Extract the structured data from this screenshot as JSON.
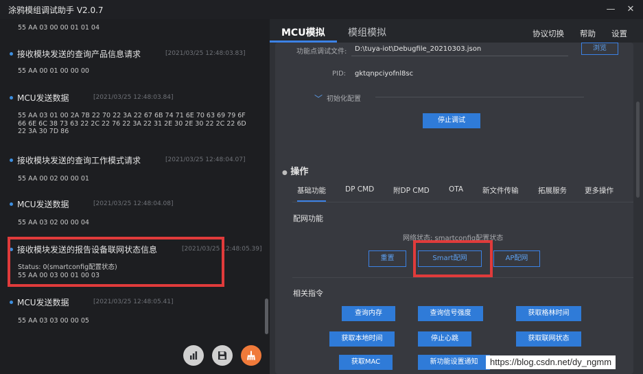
{
  "window": {
    "title": "涂鸦模组调试助手 V2.0.7",
    "minimize_glyph": "—",
    "close_glyph": "✕"
  },
  "log": {
    "entries": [
      {
        "title": "",
        "time": "",
        "body": "55 AA 03 00 00 01 01 04"
      },
      {
        "title": "接收模块发送的查询产品信息请求",
        "time": "[2021/03/25 12:48:03.83]",
        "body": "55 AA 00 01 00 00 00"
      },
      {
        "title": "MCU发送数据",
        "time": "[2021/03/25 12:48:03.84]",
        "body": "55 AA 03 01 00 2A 7B 22 70 22 3A 22 67 6B 74 71 6E 70 63 69 79 6F\n66 6E 6C 38 73 63 22 2C 22 76 22 3A 22 31 2E 30 2E 30 22 2C 22 6D\n22 3A 30 7D 86"
      },
      {
        "title": "接收模块发送的查询工作模式请求",
        "time": "[2021/03/25 12:48:04.07]",
        "body": "55 AA 00 02 00 00 01"
      },
      {
        "title": "MCU发送数据",
        "time": "[2021/03/25 12:48:04.08]",
        "body": "55 AA 03 02 00 00 04"
      },
      {
        "title": "接收模块发送的报告设备联网状态信息",
        "time": "[2021/03/25 12:48:05.39]",
        "body": "Status: 0(smartconfig配置状态)\n55 AA 00 03 00 01 00 03"
      },
      {
        "title": "MCU发送数据",
        "time": "[2021/03/25 12:48:05.41]",
        "body": "55 AA 03 03 00 00 05"
      }
    ]
  },
  "fabs": [
    "chart-icon",
    "save-icon",
    "clear-icon"
  ],
  "header": {
    "tabs": [
      {
        "label": "MCU模拟"
      },
      {
        "label": "模组模拟"
      }
    ],
    "menu": {
      "protocol": "协议切换",
      "help": "帮助",
      "settings": "设置"
    }
  },
  "config": {
    "file_label": "功能点调试文件:",
    "file_value": "D:\\tuya-iot\\Debugfile_20210303.json",
    "browse_label": "浏览",
    "pid_label": "PID:",
    "pid_value": "gktqnpciyofnl8sc",
    "init_label": "初始化配置",
    "stop_label": "停止调试"
  },
  "operations": {
    "title": "操作",
    "tabs": [
      "基础功能",
      "DP CMD",
      "附DP CMD",
      "OTA",
      "新文件传输",
      "拓展服务",
      "更多操作"
    ],
    "network_section": "配网功能",
    "network_status": "网络状态: smartconfig配置状态",
    "reset_label": "重置",
    "smart_label": "Smart配网",
    "ap_label": "AP配网",
    "commands_section": "相关指令",
    "commands": [
      "查询内存",
      "查询信号强度",
      "获取格林时间",
      "获取本地时间",
      "停止心跳",
      "获取联网状态",
      "获取MAC",
      "新功能设置通知"
    ]
  },
  "watermark": "https://blog.csdn.net/dy_ngmm",
  "colors": {
    "accent": "#3c82e6",
    "highlight": "#e03b3b",
    "fab_orange": "#f07a3a"
  }
}
